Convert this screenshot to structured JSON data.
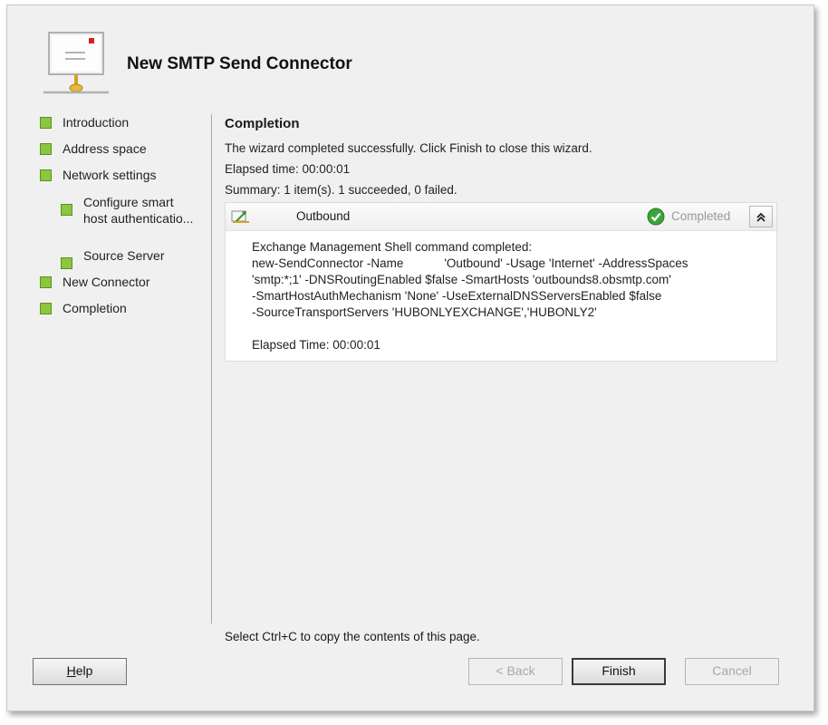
{
  "wizard": {
    "title": "New SMTP Send Connector"
  },
  "steps": [
    {
      "label": "Introduction",
      "level": 0
    },
    {
      "label": "Address space",
      "level": 0
    },
    {
      "label": "Network settings",
      "level": 0
    },
    {
      "label": "Configure smart\nhost authenticatio...",
      "level": 1
    },
    {
      "label": "Source Server",
      "level": 1
    },
    {
      "label": "New Connector",
      "level": 0
    },
    {
      "label": "Completion",
      "level": 0
    }
  ],
  "content": {
    "heading": "Completion",
    "message": "The wizard completed successfully. Click Finish to close this wizard.",
    "elapsed": "Elapsed time: 00:00:01",
    "summary": "Summary: 1 item(s). 1 succeeded, 0 failed.",
    "copy_hint": "Select Ctrl+C to copy the contents of this page."
  },
  "result": {
    "item_name": "Outbound",
    "status": "Completed",
    "collapse_glyph": "⌃",
    "lines": [
      "Exchange Management Shell command completed:",
      "new-SendConnector -Name            'Outbound' -Usage 'Internet' -AddressSpaces",
      "'smtp:*;1' -DNSRoutingEnabled $false -SmartHosts 'outbounds8.obsmtp.com'",
      "-SmartHostAuthMechanism 'None' -UseExternalDNSServersEnabled $false",
      "-SourceTransportServers 'HUBONLYEXCHANGE','HUBONLY2'",
      "",
      "Elapsed Time: 00:00:01"
    ]
  },
  "buttons": {
    "help": "Help",
    "back": "< Back",
    "finish": "Finish",
    "cancel": "Cancel"
  },
  "colors": {
    "step_bullet": "#8cc63f",
    "status_check": "#3aa53a"
  }
}
